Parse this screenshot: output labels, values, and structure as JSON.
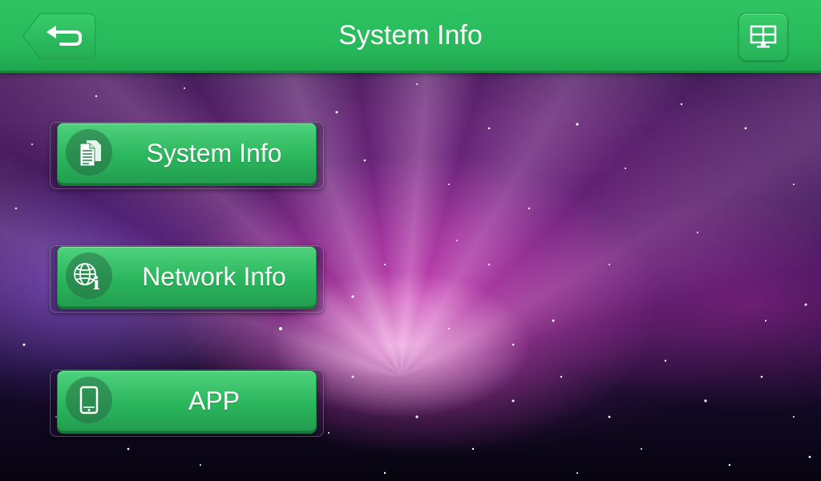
{
  "header": {
    "title": "System Info",
    "back_icon": "back-arrow-icon",
    "menu_icon": "grid-monitor-icon",
    "bar_color": "#27b85a"
  },
  "menu": {
    "items": [
      {
        "label": "System Info",
        "icon": "document-icon"
      },
      {
        "label": "Network Info",
        "icon": "globe-info-icon"
      },
      {
        "label": "APP",
        "icon": "phone-icon"
      }
    ]
  }
}
